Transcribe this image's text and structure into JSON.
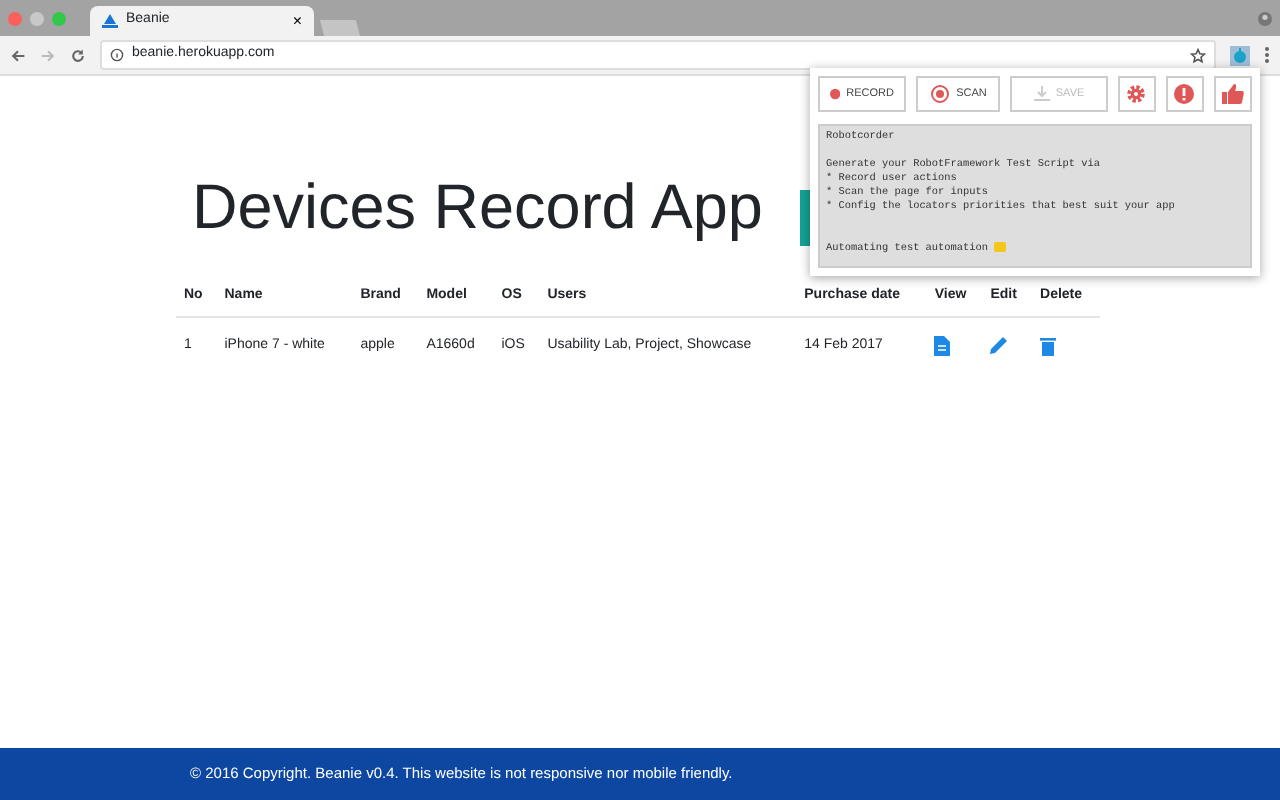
{
  "browser": {
    "tab_title": "Beanie",
    "tab_close": "×",
    "url": "beanie.herokuapp.com"
  },
  "page": {
    "title": "Devices Record App"
  },
  "table": {
    "columns": [
      "No",
      "Name",
      "Brand",
      "Model",
      "OS",
      "Users",
      "Purchase date",
      "View",
      "Edit",
      "Delete"
    ],
    "rows": [
      {
        "cells": [
          "1",
          "iPhone 7 - white",
          "apple",
          "A1660d",
          "iOS",
          "Usability Lab, Project, Showcase",
          "14 Feb 2017"
        ]
      }
    ]
  },
  "popup": {
    "buttons": [
      {
        "kind": "record",
        "label": "RECORD",
        "disabled": false
      },
      {
        "kind": "scan",
        "label": "SCAN",
        "disabled": false
      },
      {
        "kind": "save",
        "label": "SAVE",
        "disabled": true
      }
    ],
    "icon_buttons": [
      {
        "kind": "settings"
      },
      {
        "kind": "info"
      },
      {
        "kind": "like"
      }
    ],
    "text": "Robotcorder\n\nGenerate your RobotFramework Test Script via\n* Record user actions\n* Scan the page for inputs\n* Config the locators priorities that best suit your app\n\n\nAutomating test automation"
  },
  "footer": "© 2016 Copyright. Beanie v0.4. This website is not responsive nor mobile friendly."
}
